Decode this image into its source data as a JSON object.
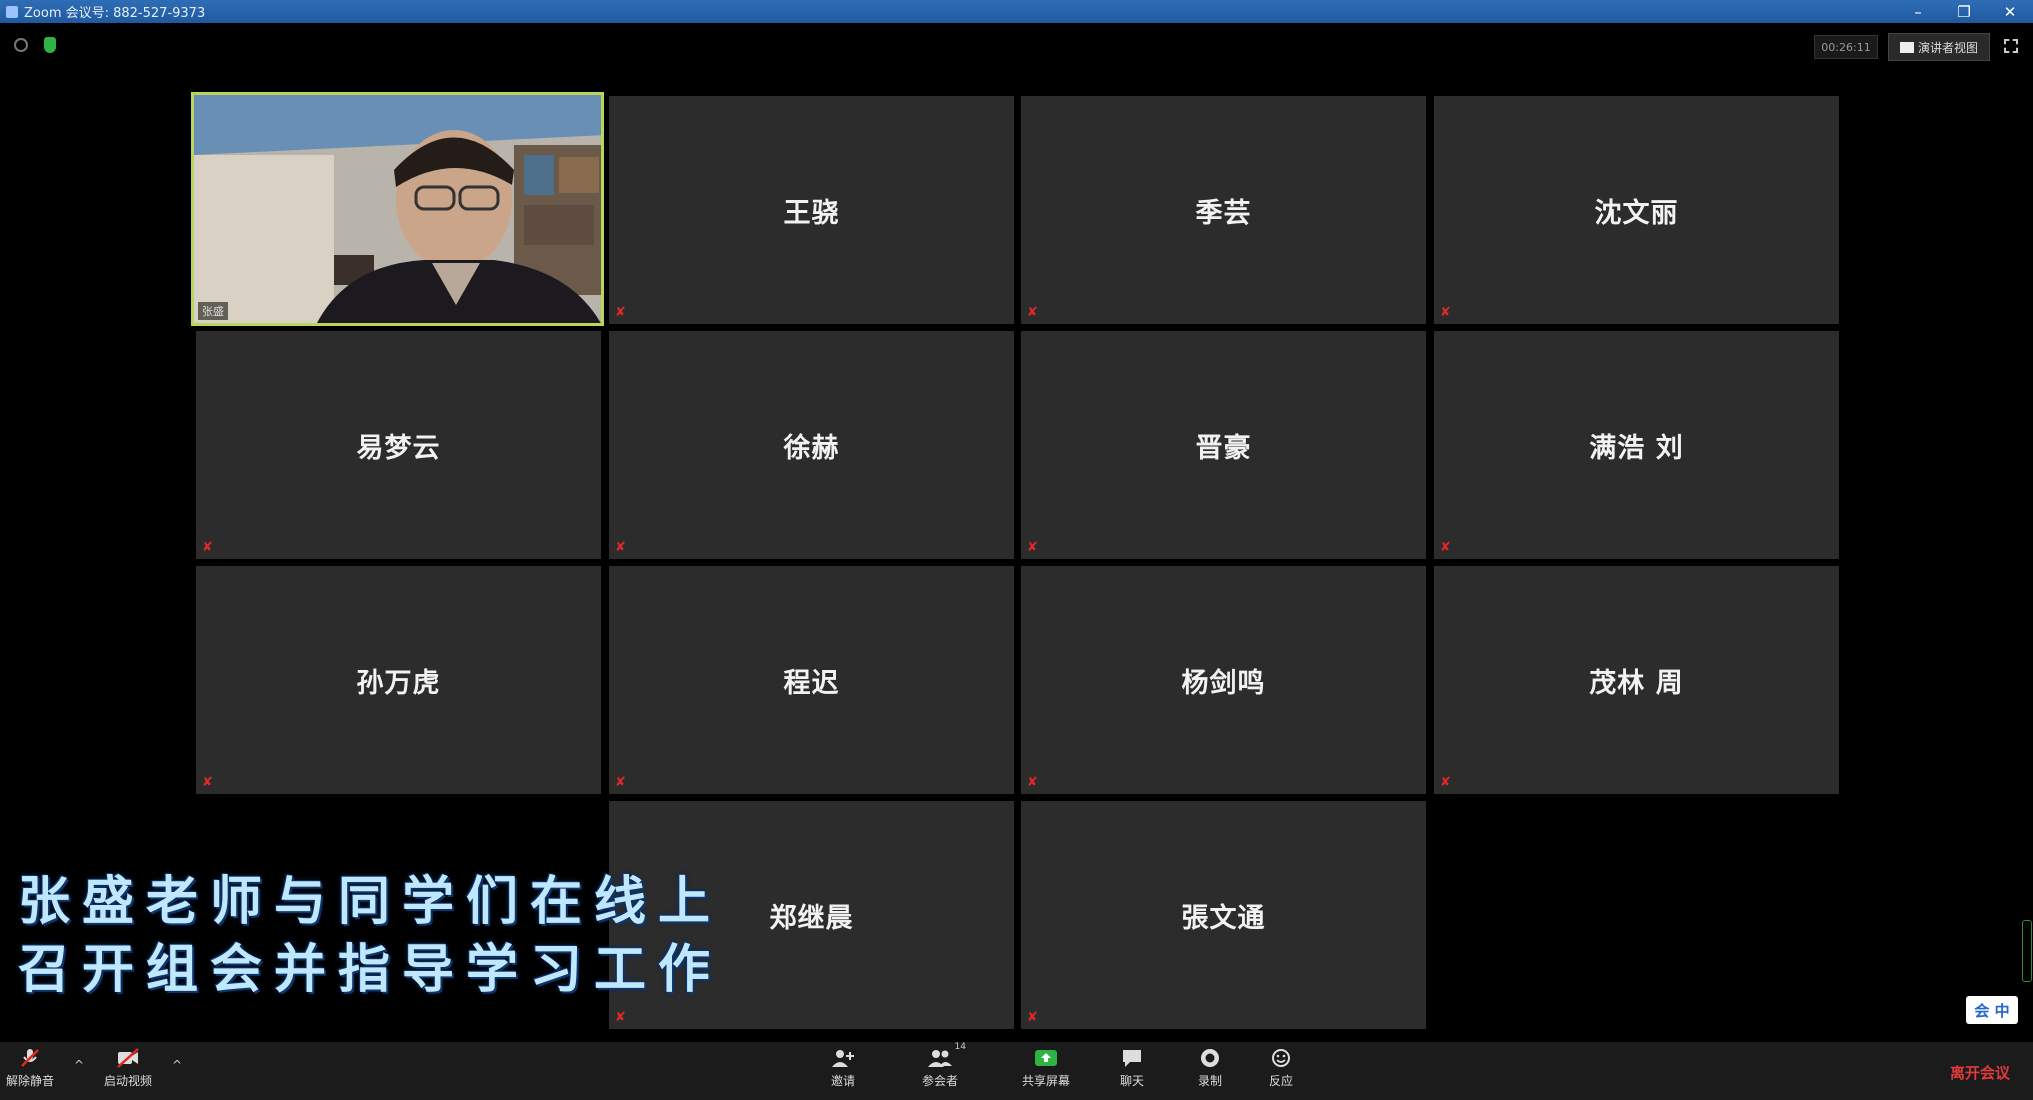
{
  "window": {
    "title": "Zoom 会议号: 882-527-9373",
    "minimize": "–",
    "restore": "❐",
    "close": "✕"
  },
  "top_bar": {
    "timer": "00:26:11",
    "view_button": "演讲者视图"
  },
  "gallery": {
    "active_video_label": "张盛",
    "tiles": [
      {
        "name": "王骁"
      },
      {
        "name": "季芸"
      },
      {
        "name": "沈文丽"
      },
      {
        "name": "易梦云"
      },
      {
        "name": "徐赫"
      },
      {
        "name": "晋豪"
      },
      {
        "name": "满浩 刘"
      },
      {
        "name": "孙万虎"
      },
      {
        "name": "程迟"
      },
      {
        "name": "杨剑鸣"
      },
      {
        "name": "茂林 周"
      },
      {
        "name": "郑继晨"
      },
      {
        "name": "張文通"
      }
    ]
  },
  "caption": {
    "line1": "张盛老师与同学们在线上",
    "line2": "召开组会并指导学习工作"
  },
  "lang_chip": "会 中",
  "toolbar": {
    "unmute": "解除静音",
    "start_video": "启动视频",
    "invite": "邀请",
    "participants": "参会者",
    "participant_count": "14",
    "share_screen": "共享屏幕",
    "chat": "聊天",
    "record": "录制",
    "reactions": "反应",
    "end_meeting": "离开会议"
  },
  "colors": {
    "active_speaker_border": "#b8d65a",
    "muted_icon": "#e02828",
    "share_green": "#2fb344",
    "end_red": "#e23a3a"
  }
}
